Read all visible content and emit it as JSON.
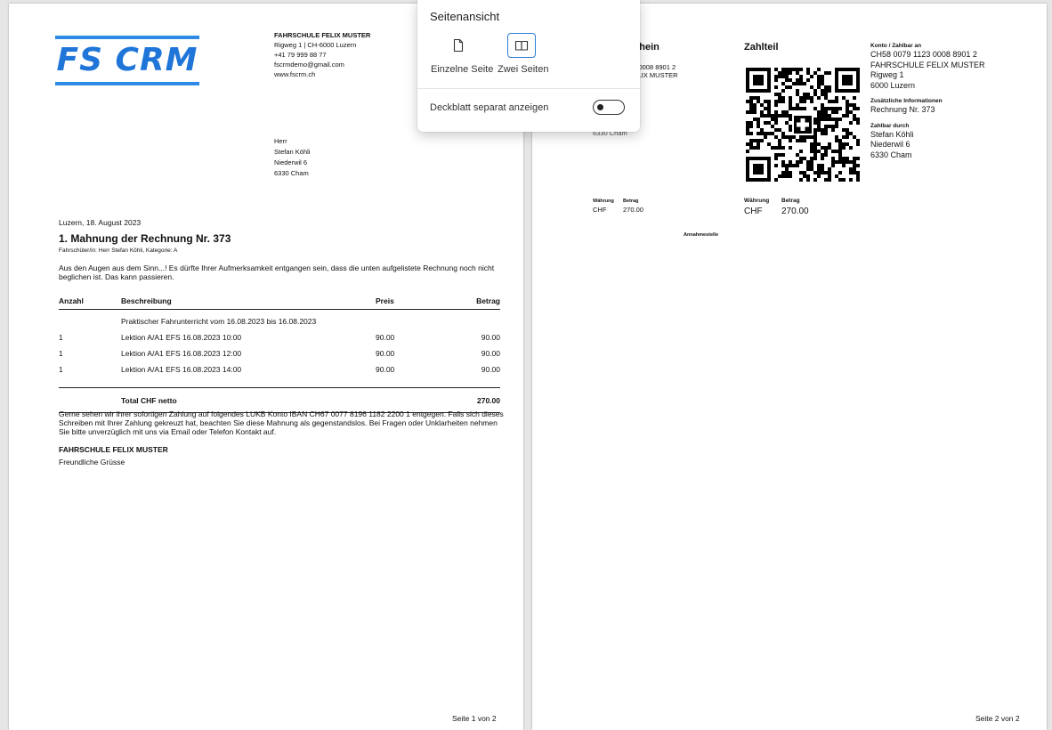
{
  "popup": {
    "title": "Seitenansicht",
    "option_single": "Einzelne Seite",
    "option_two": "Zwei Seiten",
    "selected": "Zwei Seiten",
    "toggle_label": "Deckblatt separat anzeigen",
    "toggle_on": false
  },
  "page1": {
    "logo_text": "FS CRM",
    "company": {
      "name": "FAHRSCHULE FELIX MUSTER",
      "address": "Rigweg 1 | CH-6000 Luzern",
      "phone": "+41 79 999 88 77",
      "email": "fscrmdemo@gmail.com",
      "web": "www.fscrm.ch"
    },
    "recipient": {
      "salutation": "Herr",
      "name": "Stefan Köhli",
      "street": "Niederwil 6",
      "city": "6330 Cham"
    },
    "date_line": "Luzern, 18. August 2023",
    "heading": "1. Mahnung der Rechnung Nr. 373",
    "student_line": "Fahrschüler/in:  Herr Stefan Köhli, Kategorie: A",
    "intro": "Aus den Augen aus dem Sinn...! Es dürfte Ihrer Aufmerksamkeit entgangen sein, dass die unten aufgelistete Rechnung noch nicht beglichen ist. Das kann passieren.",
    "table": {
      "headers": [
        "Anzahl",
        "Beschreibung",
        "Preis",
        "Betrag"
      ],
      "section": "Praktischer Fahrunterricht vom 16.08.2023 bis 16.08.2023",
      "rows": [
        {
          "qty": "1",
          "desc": "Lektion A/A1 EFS 16.08.2023 10:00",
          "price": "90.00",
          "amount": "90.00"
        },
        {
          "qty": "1",
          "desc": "Lektion A/A1 EFS 16.08.2023 12:00",
          "price": "90.00",
          "amount": "90.00"
        },
        {
          "qty": "1",
          "desc": "Lektion A/A1 EFS 16.08.2023 14:00",
          "price": "90.00",
          "amount": "90.00"
        }
      ],
      "total_label": "Total CHF netto",
      "total": "270.00"
    },
    "outro": "Gerne sehen wir ihrer sofortigen Zahlung auf folgendes LUKB Konto IBAN CH67 0077 8196 1182 2200 1 entgegen. Falls sich dieses Schreiben mit Ihrer Zahlung gekreuzt hat, beachten Sie diese Mahnung als gegenstandslos. Bei Fragen oder Unklarheiten nehmen Sie bitte unverzüglich mit uns via Email oder Telefon Kontakt auf.",
    "signature_company": "FAHRSCHULE FELIX MUSTER",
    "closing": "Freundliche Grüsse",
    "footer": "Seite 1 von 2"
  },
  "page2": {
    "receipt_title": "schein",
    "receipt_iban": "23 0008 8901 2",
    "receipt_name": "FELIX MUSTER",
    "receipt_city": "6330 Cham",
    "receipt_currency_label": "Währung",
    "receipt_amount_label": "Betrag",
    "receipt_currency": "CHF",
    "receipt_amount": "270.00",
    "acceptance_point": "Annahmestelle",
    "payment_title": "Zahlteil",
    "currency_label": "Währung",
    "amount_label": "Betrag",
    "currency": "CHF",
    "amount": "270.00",
    "account_label": "Konto / Zahlbar an",
    "iban": "CH58 0079 1123 0008 8901 2",
    "creditor_name": "FAHRSCHULE FELIX MUSTER",
    "creditor_street": "Rigweg 1",
    "creditor_city": "6000 Luzern",
    "additional_label": "Zusätzliche Informationen",
    "additional": "Rechnung Nr. 373",
    "payable_by_label": "Zahlbar durch",
    "debtor_name": "Stefan Köhli",
    "debtor_street": "Niederwil 6",
    "debtor_city": "6330 Cham",
    "footer": "Seite 2 von 2"
  }
}
